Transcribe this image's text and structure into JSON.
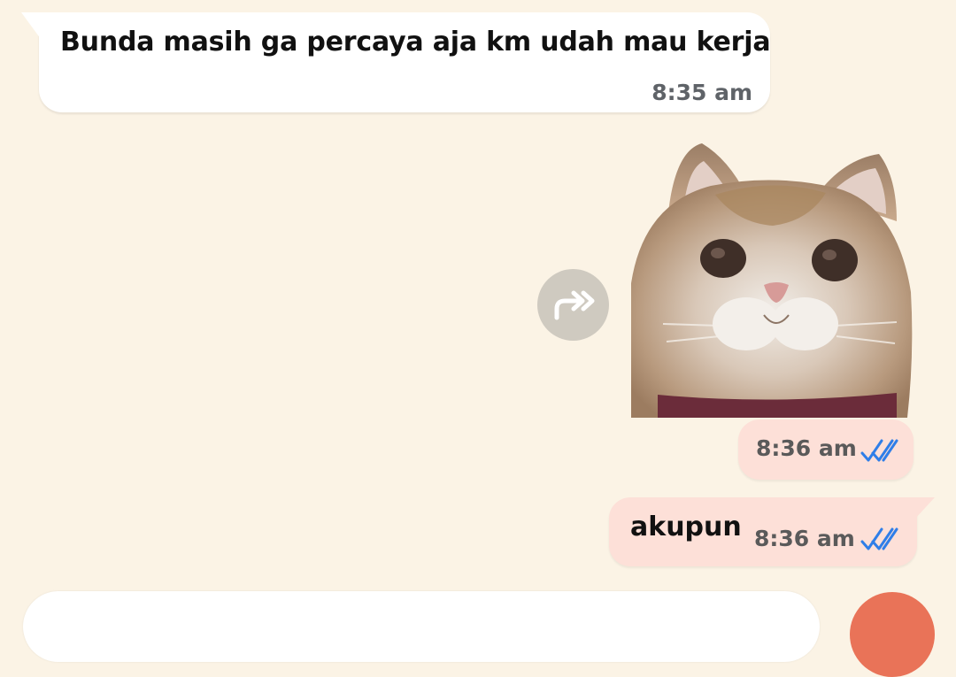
{
  "messages": [
    {
      "direction": "incoming",
      "text": "Bunda masih ga percaya aja km udah mau kerja",
      "time": "8:35 am"
    },
    {
      "direction": "outgoing",
      "type": "sticker",
      "sticker_subject": "cat",
      "time": "8:36 am",
      "status_icon": "double-check-icon"
    },
    {
      "direction": "outgoing",
      "text": "akupun",
      "time": "8:36 am",
      "status_icon": "double-check-icon"
    }
  ],
  "icons": {
    "forward": "forward-icon",
    "read_receipt": "double-check-icon"
  },
  "colors": {
    "background": "#fbf3e5",
    "incoming_bubble": "#ffffff",
    "outgoing_bubble": "#fde0d8",
    "read_tick": "#2f7ee8",
    "forward_button": "#cfcac0",
    "send_button": "#e97358"
  }
}
